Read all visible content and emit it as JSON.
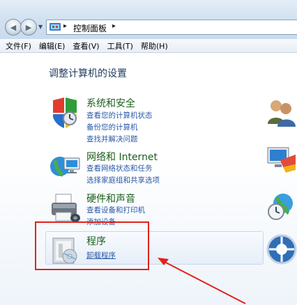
{
  "address_bar": {
    "crumbs": [
      "控制面板"
    ],
    "separator": "▸"
  },
  "menu": {
    "items": [
      "文件(F)",
      "编辑(E)",
      "查看(V)",
      "工具(T)",
      "帮助(H)"
    ]
  },
  "page": {
    "title": "调整计算机的设置"
  },
  "categories": [
    {
      "title": "系统和安全",
      "links": [
        "查看您的计算机状态",
        "备份您的计算机",
        "查找并解决问题"
      ]
    },
    {
      "title": "网络和 Internet",
      "links": [
        "查看网络状态和任务",
        "选择家庭组和共享选项"
      ]
    },
    {
      "title": "硬件和声音",
      "links": [
        "查看设备和打印机",
        "添加设备"
      ]
    },
    {
      "title": "程序",
      "links": [
        "卸载程序"
      ]
    }
  ],
  "colors": {
    "accent_highlight": "#e2211c",
    "category_title": "#1a5e1a",
    "link": "#2a59a8"
  }
}
